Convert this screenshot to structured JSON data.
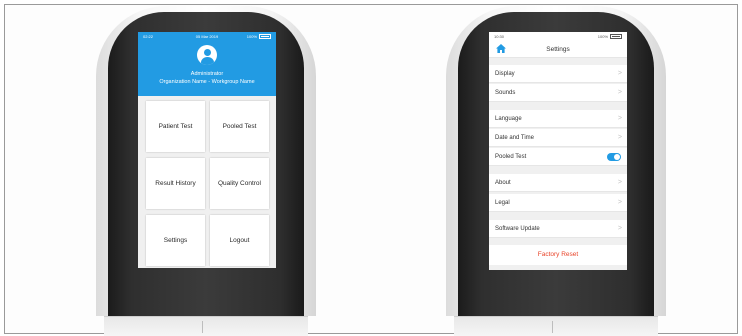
{
  "left_device": {
    "statusbar": {
      "time": "02:22",
      "date": "05 Mar 2019",
      "battery": "100%"
    },
    "user": {
      "role": "Administrator",
      "organization": "Organization Name - Workgroup Name",
      "avatar_icon": "user-icon"
    },
    "menu": [
      {
        "name": "patient-test-tile",
        "label": "Patient Test"
      },
      {
        "name": "pooled-test-tile",
        "label": "Pooled Test"
      },
      {
        "name": "result-history-tile",
        "label": "Result History"
      },
      {
        "name": "quality-control-tile",
        "label": "Quality Control"
      },
      {
        "name": "settings-tile",
        "label": "Settings"
      },
      {
        "name": "logout-tile",
        "label": "Logout"
      }
    ],
    "accent_color": "#229be3"
  },
  "right_device": {
    "statusbar": {
      "time": "10:30",
      "battery": "100%"
    },
    "header": {
      "title": "Settings",
      "home_icon": "home-icon"
    },
    "rows": [
      {
        "label": "Display",
        "chevron": ">"
      },
      {
        "label": "Sounds",
        "chevron": ">"
      },
      {
        "label": "Language",
        "chevron": ">"
      },
      {
        "label": "Date and Time",
        "chevron": ">"
      },
      {
        "label": "Pooled Test",
        "toggle_on": true
      },
      {
        "label": "About",
        "chevron": ">"
      },
      {
        "label": "Legal",
        "chevron": ">"
      },
      {
        "label": "Software Update",
        "chevron": ">"
      }
    ],
    "factory_reset_label": "Factory Reset",
    "reset_color": "#e8452a"
  }
}
